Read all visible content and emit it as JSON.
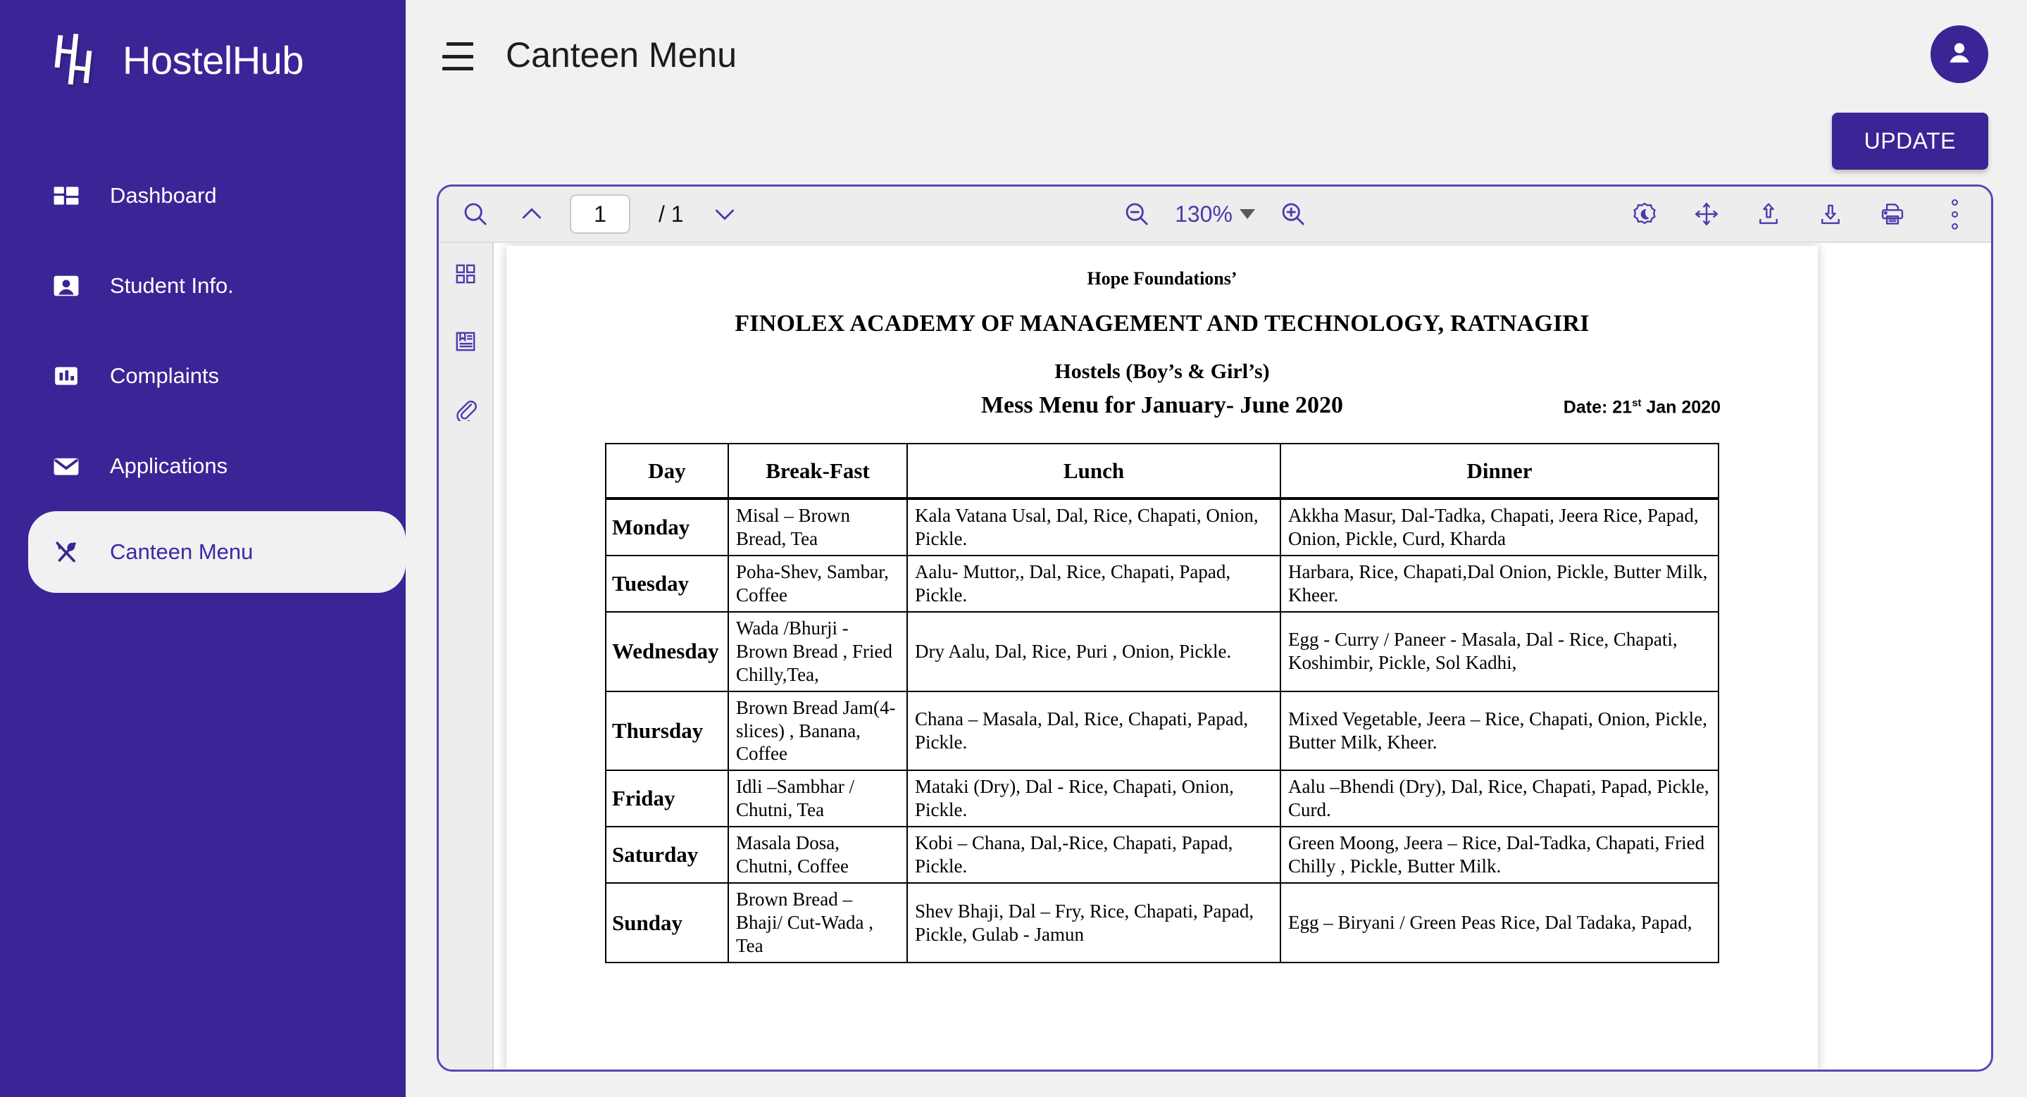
{
  "sidebar": {
    "brand": {
      "name": "HostelHub",
      "logo_icon": "hostelhub-h-logo"
    },
    "items": [
      {
        "label": "Dashboard",
        "icon": "dashboard-grid-icon",
        "active": false
      },
      {
        "label": "Student Info.",
        "icon": "user-badge-icon",
        "active": false
      },
      {
        "label": "Complaints",
        "icon": "bar-chart-icon",
        "active": false
      },
      {
        "label": "Applications",
        "icon": "envelope-icon",
        "active": false
      },
      {
        "label": "Canteen Menu",
        "icon": "fork-spoon-icon",
        "active": true
      }
    ],
    "background_color": "#3B2596",
    "active_text_color": "#4026a8"
  },
  "topbar": {
    "menu_icon": "hamburger-icon",
    "title": "Canteen Menu",
    "avatar_icon": "person-avatar-icon",
    "update_label": "UPDATE",
    "accent_color": "#3B2596"
  },
  "pdf_toolbar": {
    "search_icon": "search-icon",
    "prev_page_icon": "chevron-up-icon",
    "next_page_icon": "chevron-down-icon",
    "page_number": "1",
    "page_total": "/ 1",
    "zoom_out_icon": "zoom-out-icon",
    "zoom_in_icon": "zoom-in-icon",
    "zoom_level": "130%",
    "right_icons": [
      "dark-mode-icon",
      "pan-move-icon",
      "upload-icon",
      "download-icon",
      "print-icon",
      "more-options-icon"
    ]
  },
  "side_rail": {
    "icons": [
      "thumbnails-grid-icon",
      "bookmarks-outline-icon",
      "attachments-paperclip-icon"
    ]
  },
  "document": {
    "org": "Hope Foundations’",
    "college": "FINOLEX ACADEMY OF MANAGEMENT AND TECHNOLOGY, RATNAGIRI",
    "hostels": "Hostels (Boy’s & Girl’s)",
    "mess_title": "Mess Menu for January- June 2020",
    "date_prefix": "Date: 21",
    "date_sup": "st",
    "date_suffix": " Jan 2020",
    "table": {
      "headers": [
        "Day",
        "Break-Fast",
        "Lunch",
        "Dinner"
      ],
      "rows": [
        {
          "day": "Monday",
          "breakfast": "Misal – Brown Bread, Tea",
          "lunch": "Kala Vatana Usal, Dal, Rice, Chapati, Onion, Pickle.",
          "dinner": "Akkha Masur, Dal-Tadka, Chapati, Jeera Rice, Papad, Onion, Pickle, Curd, Kharda"
        },
        {
          "day": "Tuesday",
          "breakfast": "Poha-Shev, Sambar, Coffee",
          "lunch": "Aalu- Muttor,, Dal, Rice, Chapati, Papad, Pickle.",
          "dinner": "Harbara, Rice, Chapati,Dal Onion, Pickle, Butter Milk, Kheer."
        },
        {
          "day": "Wednesday",
          "breakfast": "Wada /Bhurji - Brown Bread , Fried Chilly,Tea,",
          "lunch": "Dry Aalu,  Dal, Rice, Puri , Onion, Pickle.",
          "dinner": "Egg - Curry / Paneer - Masala, Dal - Rice, Chapati, Koshimbir, Pickle, Sol Kadhi,"
        },
        {
          "day": "Thursday",
          "breakfast": "Brown Bread Jam(4-slices) , Banana, Coffee",
          "lunch": "Chana – Masala, Dal, Rice, Chapati, Papad, Pickle.",
          "dinner": " Mixed Vegetable, Jeera – Rice, Chapati, Onion, Pickle, Butter Milk, Kheer."
        },
        {
          "day": "Friday",
          "breakfast": "Idli –Sambhar / Chutni,   Tea",
          "lunch": "Mataki (Dry), Dal - Rice, Chapati, Onion, Pickle.",
          "dinner": "Aalu –Bhendi (Dry), Dal, Rice, Chapati, Papad, Pickle, Curd."
        },
        {
          "day": "Saturday",
          "breakfast": "Masala Dosa, Chutni, Coffee",
          "lunch": "Kobi – Chana, Dal,-Rice, Chapati, Papad, Pickle.",
          "dinner": "Green Moong, Jeera – Rice, Dal-Tadka, Chapati, Fried Chilly , Pickle, Butter Milk."
        },
        {
          "day": "Sunday",
          "breakfast": "Brown Bread – Bhaji/ Cut-Wada , Tea",
          "lunch": "Shev Bhaji, Dal – Fry, Rice, Chapati, Papad, Pickle, Gulab - Jamun",
          "dinner": "Egg – Biryani / Green Peas Rice, Dal Tadaka, Papad,"
        }
      ]
    }
  }
}
